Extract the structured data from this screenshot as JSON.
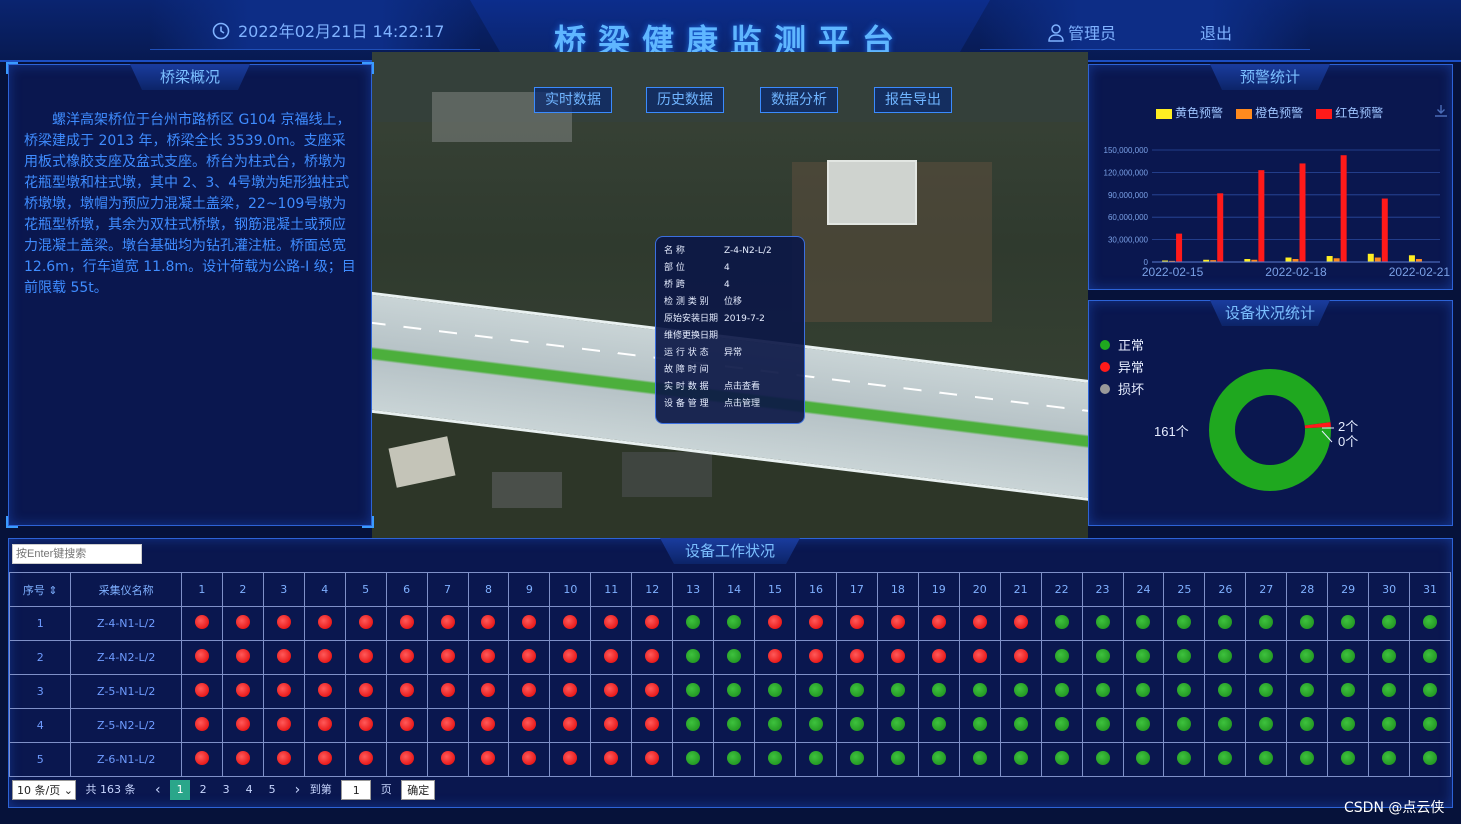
{
  "header": {
    "datetime": "2022年02月21日  14:22:17",
    "title": "桥梁健康监测平台",
    "user": "管理员",
    "logout": "退出"
  },
  "nav": {
    "items": [
      {
        "label": "实时数据"
      },
      {
        "label": "历史数据"
      },
      {
        "label": "数据分析"
      },
      {
        "label": "报告导出"
      }
    ]
  },
  "overview": {
    "title": "桥梁概况",
    "text": "螺洋高架桥位于台州市路桥区 G104 京福线上，桥梁建成于 2013 年，桥梁全长 3539.0m。支座采用板式橡胶支座及盆式支座。桥台为柱式台，桥墩为花瓶型墩和柱式墩，其中 2、3、4号墩为矩形独柱式桥墩墩，墩帽为预应力混凝土盖梁，22~109号墩为花瓶型桥墩，其余为双柱式桥墩，钢筋混凝土或预应力混凝土盖梁。墩台基础均为钻孔灌注桩。桥面总宽 12.6m，行车道宽 11.8m。设计荷载为公路-I 级；目前限载 55t。"
  },
  "popup": {
    "rows": [
      {
        "k": "名        称",
        "v": "Z-4-N2-L/2"
      },
      {
        "k": "部        位",
        "v": "4"
      },
      {
        "k": "桥        跨",
        "v": "4"
      },
      {
        "k": "检 测 类 别",
        "v": "位移"
      },
      {
        "k": "原始安装日期",
        "v": "2019-7-2"
      },
      {
        "k": "维修更换日期",
        "v": ""
      },
      {
        "k": "运 行 状 态",
        "v": "异常"
      },
      {
        "k": "故 障 时 间",
        "v": ""
      },
      {
        "k": "实 时 数 据",
        "v": "点击查看"
      },
      {
        "k": "设 备 管 理",
        "v": "点击管理"
      }
    ]
  },
  "colors": {
    "yellow": "#ffee22",
    "orange": "#ff8a1e",
    "red": "#ff1a1a",
    "normal": "#1fa81f",
    "abnormal": "#ff1a1a",
    "damaged": "#9a9a9a"
  },
  "chart_data": [
    {
      "type": "bar",
      "title": "预警统计",
      "categories": [
        "2022-02-15",
        "",
        "",
        "2022-02-18",
        "",
        "",
        "2022-02-21"
      ],
      "series": [
        {
          "name": "黄色预警",
          "values": [
            2000000,
            3000000,
            4000000,
            6000000,
            8000000,
            11000000,
            9000000
          ]
        },
        {
          "name": "橙色预警",
          "values": [
            1500000,
            2500000,
            3000000,
            4000000,
            5000000,
            6000000,
            4000000
          ]
        },
        {
          "name": "红色预警",
          "values": [
            38000000,
            92000000,
            123000000,
            132000000,
            143000000,
            85000000,
            0
          ]
        }
      ],
      "yticks": [
        "0",
        "30,000,000",
        "60,000,000",
        "90,000,000",
        "120,000,000",
        "150,000,000"
      ],
      "ylim": [
        0,
        150000000
      ],
      "grid": true,
      "legend": "top"
    },
    {
      "type": "pie",
      "title": "设备状况统计",
      "labels": [
        "正常",
        "异常",
        "损坏"
      ],
      "values": [
        161,
        2,
        0
      ],
      "slice_labels": [
        "161个",
        "2个",
        "0个"
      ],
      "legend": "left"
    }
  ],
  "table": {
    "title": "设备工作状况",
    "search_placeholder": "按Enter键搜索",
    "col_index": "序号",
    "col_name": "采集仪名称",
    "days": [
      "1",
      "2",
      "3",
      "4",
      "5",
      "6",
      "7",
      "8",
      "9",
      "10",
      "11",
      "12",
      "13",
      "14",
      "15",
      "16",
      "17",
      "18",
      "19",
      "20",
      "21",
      "22",
      "23",
      "24",
      "25",
      "26",
      "27",
      "28",
      "29",
      "30",
      "31"
    ],
    "rows": [
      {
        "idx": "1",
        "name": "Z-4-N1-L/2",
        "status": "rrrrrrrrrrrrggrrrrrrrgggggggggg"
      },
      {
        "idx": "2",
        "name": "Z-4-N2-L/2",
        "status": "rrrrrrrrrrrrggrrrrrrrgggggggggg"
      },
      {
        "idx": "3",
        "name": "Z-5-N1-L/2",
        "status": "rrrrrrrrrrrrgggggggggggggggggggg"
      },
      {
        "idx": "4",
        "name": "Z-5-N2-L/2",
        "status": "rrrrrrrrrrrrgggggggggggggggggggg"
      },
      {
        "idx": "5",
        "name": "Z-6-N1-L/2",
        "status": "rrrrrrrrrrrrgggggggggggggggggggg"
      }
    ]
  },
  "pagination": {
    "page_size": "10 条/页",
    "total": "共 163 条",
    "pages": [
      "1",
      "2",
      "3",
      "4",
      "5"
    ],
    "current": "1",
    "goto_label": "到第",
    "goto_value": "1",
    "page_unit": "页",
    "confirm": "确定"
  },
  "watermark": "CSDN @点云侠"
}
